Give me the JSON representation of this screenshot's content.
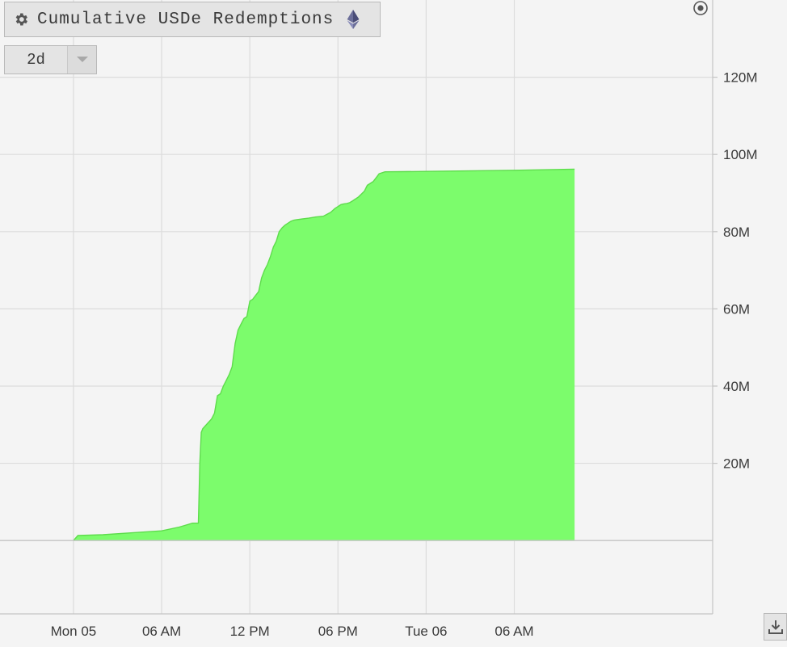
{
  "header": {
    "title": "Cumulative USDe Redemptions",
    "gear_icon": "gear-icon",
    "chain_icon": "ethereum-icon"
  },
  "range_selector": {
    "value": "2d",
    "dropdown_icon": "chevron-down-icon"
  },
  "toolbar": {
    "settings_icon": "target-circle-icon",
    "download_icon": "download-icon"
  },
  "colors": {
    "fill": "#7cfc6c",
    "line": "#5edc4c",
    "grid": "#dcdcdc",
    "background": "#f4f4f4"
  },
  "chart_data": {
    "type": "area",
    "title": "Cumulative USDe Redemptions",
    "xlabel": "",
    "ylabel": "",
    "x_axis": {
      "unit": "hours since Mon 05 00:00",
      "range": [
        -5,
        43.5
      ],
      "ticks": [
        {
          "x": 0,
          "label": "Mon 05"
        },
        {
          "x": 6,
          "label": "06 AM"
        },
        {
          "x": 12,
          "label": "12 PM"
        },
        {
          "x": 18,
          "label": "06 PM"
        },
        {
          "x": 24,
          "label": "Tue 06"
        },
        {
          "x": 30,
          "label": "06 AM"
        }
      ]
    },
    "y_axis": {
      "unit": "USD",
      "range": [
        -19000000,
        140000000
      ],
      "position": "right",
      "ticks": [
        {
          "y": 20000000,
          "label": "20M"
        },
        {
          "y": 40000000,
          "label": "40M"
        },
        {
          "y": 60000000,
          "label": "60M"
        },
        {
          "y": 80000000,
          "label": "80M"
        },
        {
          "y": 100000000,
          "label": "100M"
        },
        {
          "y": 120000000,
          "label": "120M"
        }
      ]
    },
    "grid": true,
    "legend": "none",
    "series": [
      {
        "x": [
          0,
          0.3,
          2,
          4,
          6,
          7.2,
          8.1,
          8.5,
          8.6,
          8.7,
          8.8,
          9.4,
          9.6,
          9.8,
          10.0,
          10.2,
          10.4,
          10.6,
          10.8,
          11.0,
          11.2,
          11.4,
          11.6,
          11.8,
          12.0,
          12.2,
          12.4,
          12.6,
          12.8,
          13.0,
          13.2,
          13.4,
          13.6,
          13.8,
          14.0,
          14.2,
          14.4,
          14.6,
          14.8,
          15.0,
          15.2,
          15.4,
          15.6,
          16.0,
          16.5,
          17.0,
          17.5,
          17.8,
          18.0,
          18.2,
          18.4,
          18.6,
          18.8,
          19.0,
          19.4,
          19.8,
          20.0,
          20.2,
          20.4,
          20.6,
          20.8,
          21.2,
          24,
          30,
          34.1
        ],
        "y": [
          0,
          1300000,
          1500000,
          2000000,
          2500000,
          3500000,
          4500000,
          4500000,
          20000000,
          28000000,
          29000000,
          31500000,
          33000000,
          37500000,
          38000000,
          40000000,
          41500000,
          43000000,
          45000000,
          51000000,
          54500000,
          56000000,
          57500000,
          58000000,
          62000000,
          62500000,
          63500000,
          64500000,
          68000000,
          70000000,
          71500000,
          73500000,
          76000000,
          77500000,
          80000000,
          81000000,
          81700000,
          82200000,
          82700000,
          83000000,
          83100000,
          83200000,
          83300000,
          83500000,
          83800000,
          84000000,
          85000000,
          86000000,
          86500000,
          87000000,
          87200000,
          87300000,
          87500000,
          88000000,
          89000000,
          90500000,
          92000000,
          92500000,
          93000000,
          94000000,
          95000000,
          95500000,
          95600000,
          95900000,
          96200000
        ]
      }
    ]
  }
}
